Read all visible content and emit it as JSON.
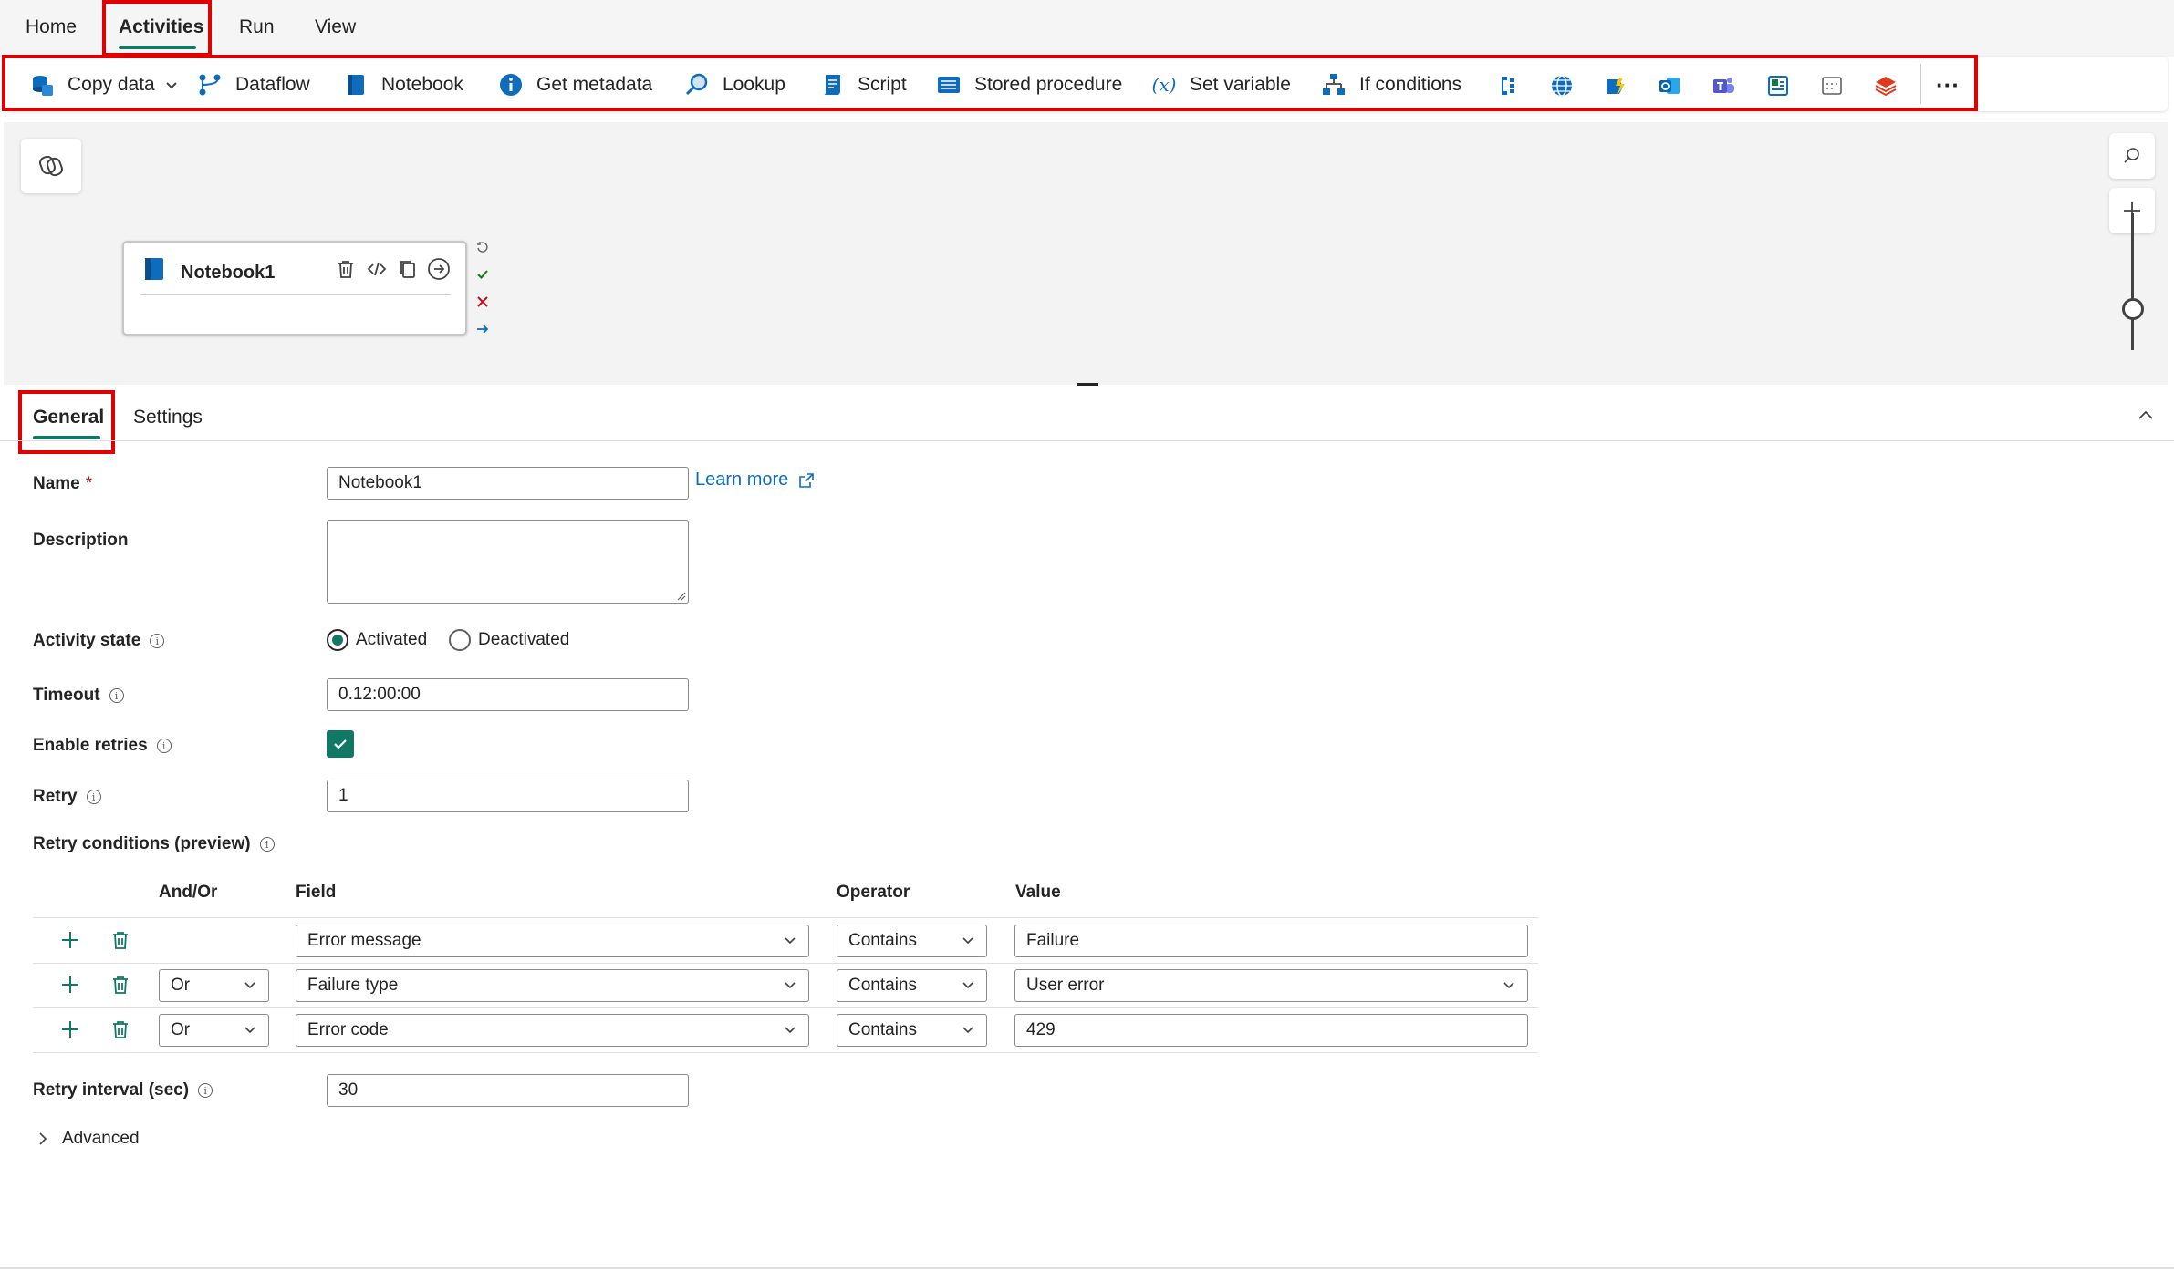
{
  "menu": {
    "items": [
      {
        "label": "Home"
      },
      {
        "label": "Activities"
      },
      {
        "label": "Run"
      },
      {
        "label": "View"
      }
    ],
    "active_index": 1
  },
  "ribbon": {
    "items": [
      {
        "label": "Copy data",
        "icon": "copy-data-icon"
      },
      {
        "label": "Dataflow",
        "icon": "dataflow-icon"
      },
      {
        "label": "Notebook",
        "icon": "notebook-icon"
      },
      {
        "label": "Get metadata",
        "icon": "get-metadata-icon"
      },
      {
        "label": "Lookup",
        "icon": "lookup-icon"
      },
      {
        "label": "Script",
        "icon": "script-icon"
      },
      {
        "label": "Stored procedure",
        "icon": "stored-procedure-icon"
      },
      {
        "label": "Set variable",
        "icon": "set-variable-icon"
      },
      {
        "label": "If conditions",
        "icon": "if-conditions-icon"
      }
    ],
    "more_icons": [
      "switch-icon",
      "web-icon",
      "webhook-icon",
      "outlook-icon",
      "teams-icon",
      "office-icon",
      "calendar-icon",
      "layers-icon"
    ],
    "more_label": "···"
  },
  "canvas": {
    "node": {
      "title": "Notebook1"
    }
  },
  "panel": {
    "tabs": [
      {
        "label": "General"
      },
      {
        "label": "Settings"
      }
    ],
    "active_tab": 0,
    "name_label": "Name",
    "required_mark": "*",
    "name_value": "Notebook1",
    "learn_more": "Learn more",
    "description_label": "Description",
    "description_value": "",
    "activity_state_label": "Activity state",
    "activated_label": "Activated",
    "deactivated_label": "Deactivated",
    "activity_state_value": "Activated",
    "timeout_label": "Timeout",
    "timeout_value": "0.12:00:00",
    "enable_retries_label": "Enable retries",
    "enable_retries_checked": true,
    "retry_label": "Retry",
    "retry_value": "1",
    "retry_conditions_label": "Retry conditions (preview)",
    "retry_table": {
      "headers": {
        "andor": "And/Or",
        "field": "Field",
        "operator": "Operator",
        "value": "Value"
      },
      "rows": [
        {
          "andor": "",
          "field": "Error message",
          "operator": "Contains",
          "value": "Failure",
          "value_is_dropdown": false
        },
        {
          "andor": "Or",
          "field": "Failure type",
          "operator": "Contains",
          "value": "User error",
          "value_is_dropdown": true
        },
        {
          "andor": "Or",
          "field": "Error code",
          "operator": "Contains",
          "value": "429",
          "value_is_dropdown": false
        }
      ]
    },
    "retry_interval_label": "Retry interval (sec)",
    "retry_interval_value": "30",
    "advanced_label": "Advanced"
  },
  "colors": {
    "accent": "#117865",
    "highlight": "#e00000",
    "link": "#0f6cbd"
  }
}
